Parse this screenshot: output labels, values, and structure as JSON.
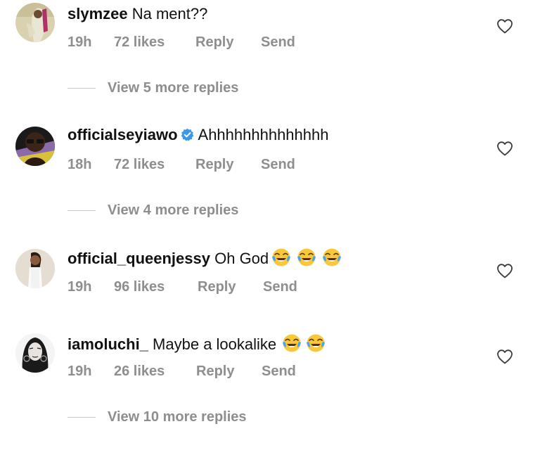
{
  "comments": [
    {
      "username": "slymzee",
      "text": "Na ment??",
      "verified": false,
      "emoji_count": 0,
      "time": "19h",
      "likes": "72 likes",
      "reply_label": "Reply",
      "send_label": "Send"
    },
    {
      "username": "officialseyiawo",
      "text": "Ahhhhhhhhhhhhhh",
      "verified": true,
      "emoji_count": 0,
      "time": "18h",
      "likes": "72 likes",
      "reply_label": "Reply",
      "send_label": "Send"
    },
    {
      "username": "official_queenjessy",
      "text": "Oh God",
      "verified": false,
      "emoji_count": 3,
      "time": "19h",
      "likes": "96 likes",
      "reply_label": "Reply",
      "send_label": "Send"
    },
    {
      "username": "iamoluchi_",
      "text": "Maybe a lookalike",
      "verified": false,
      "emoji_count": 2,
      "time": "19h",
      "likes": "26 likes",
      "reply_label": "Reply",
      "send_label": "Send"
    }
  ],
  "view_replies": [
    "View 5 more replies",
    "View 4 more replies",
    "View 10 more replies"
  ],
  "icons": {
    "like": "heart-outline-icon",
    "verified": "verified-badge-icon",
    "emoji": "face-with-tears-of-joy-emoji"
  },
  "colors": {
    "text": "#111111",
    "meta": "#8e8e8e",
    "verified": "#3897f0",
    "divider": "#c7c7c7"
  }
}
